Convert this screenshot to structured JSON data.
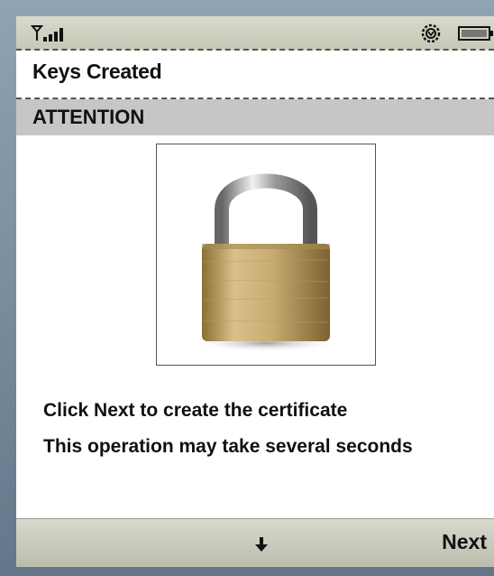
{
  "title": "Keys Created",
  "header": {
    "label": "ATTENTION"
  },
  "messages": {
    "line1": "Click Next to create the certificate",
    "line2": "This operation may take several seconds"
  },
  "softkeys": {
    "right_label": "Next",
    "center_icon": "down-arrow-icon"
  },
  "status": {
    "signal_icon": "signal-icon",
    "settings_icon": "gear-icon",
    "battery_icon": "battery-icon"
  },
  "image": {
    "icon": "padlock-icon"
  },
  "colors": {
    "header_bg": "#c6c6c6",
    "softkey_bg": "#c8c8b8",
    "frame": "#6f8290"
  }
}
